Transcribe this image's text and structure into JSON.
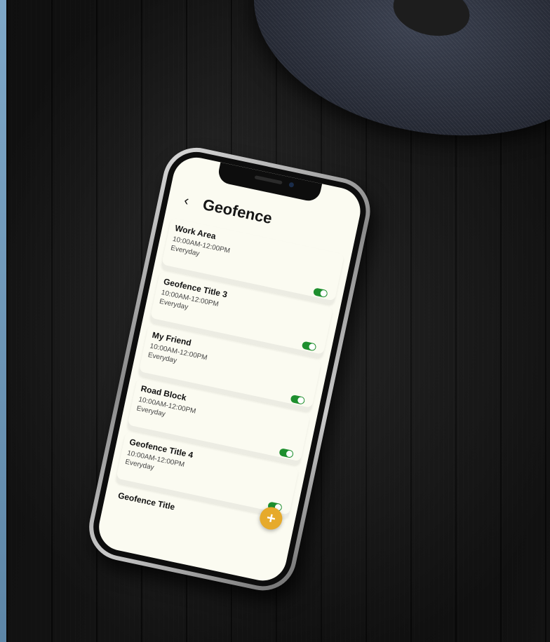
{
  "app": {
    "title": "Geofence",
    "back_icon": "chevron-left-icon"
  },
  "geofences": [
    {
      "title": "Work Area",
      "time": "10:00AM-12:00PM",
      "days": "Everyday",
      "enabled": true
    },
    {
      "title": "Geofence Title 3",
      "time": "10:00AM-12:00PM",
      "days": "Everyday",
      "enabled": true
    },
    {
      "title": "My Friend",
      "time": "10:00AM-12:00PM",
      "days": "Everyday",
      "enabled": true
    },
    {
      "title": "Road Block",
      "time": "10:00AM-12:00PM",
      "days": "Everyday",
      "enabled": true
    },
    {
      "title": "Geofence Title 4",
      "time": "10:00AM-12:00PM",
      "days": "Everyday",
      "enabled": true
    },
    {
      "title": "Geofence Title"
    }
  ],
  "fab": {
    "label": "+",
    "icon": "plus-icon"
  },
  "colors": {
    "screen_background": "#fbfbf1",
    "toggle_on": "#1e8f2e",
    "fab": "#e6aa2b",
    "text": "#151515"
  }
}
